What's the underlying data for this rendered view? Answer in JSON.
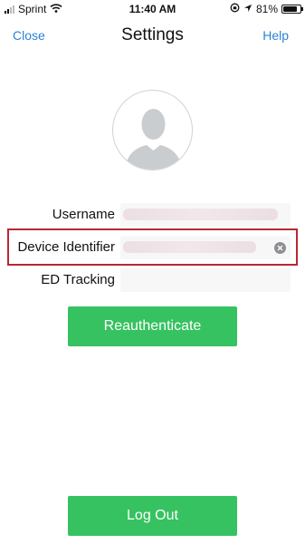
{
  "status_bar": {
    "carrier": "Sprint",
    "time": "11:40 AM",
    "battery": "81%",
    "battery_level": 0.81
  },
  "nav": {
    "close_label": "Close",
    "title": "Settings",
    "help_label": "Help"
  },
  "form": {
    "username_label": "Username",
    "username_value": "",
    "device_identifier_label": "Device Identifier",
    "device_identifier_value": "",
    "ed_tracking_label": "ED Tracking",
    "ed_tracking_value": ""
  },
  "actions": {
    "reauthenticate_label": "Reauthenticate",
    "logout_label": "Log Out"
  },
  "colors": {
    "accent_blue": "#2b83d6",
    "button_green": "#36c260",
    "highlight_red": "#b62934"
  }
}
